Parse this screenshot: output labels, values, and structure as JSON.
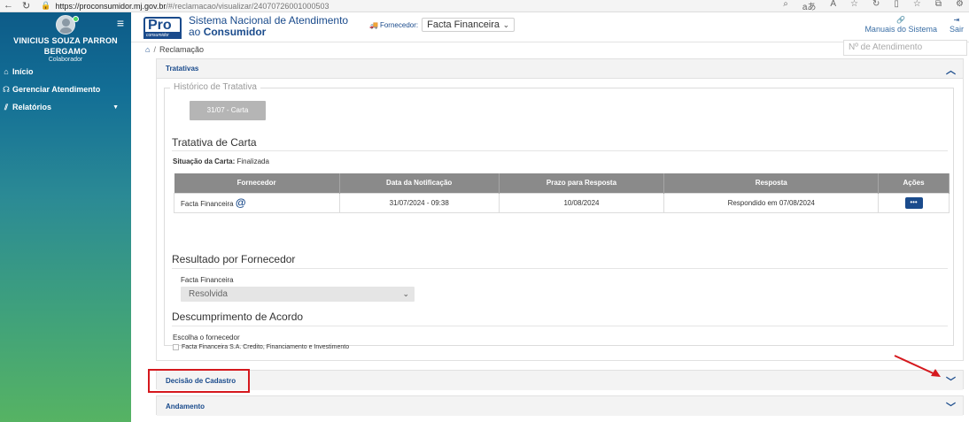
{
  "browser": {
    "url_host": "https://proconsumidor.mj.gov.br",
    "url_path": "/#/reclamacao/visualizar/24070726001000503"
  },
  "sidebar": {
    "user_name_line1": "VINICIUS SOUZA PARRON",
    "user_name_line2": "BERGAMO",
    "user_role": "Colaborador",
    "items": [
      {
        "label": "Início",
        "icon": "home-icon"
      },
      {
        "label": "Gerenciar Atendimento",
        "icon": "headset-icon"
      },
      {
        "label": "Relatórios",
        "icon": "chart-icon"
      }
    ]
  },
  "header": {
    "logo_main": "Pro",
    "logo_sub": "consumidor",
    "title_line1": "Sistema Nacional de Atendimento",
    "title_prefix": "ao ",
    "title_bold": "Consumidor",
    "supplier_label": "Fornecedor:",
    "supplier_value": "Facta Financeira",
    "manuals_label": "Manuais do Sistema",
    "exit_label": "Sair"
  },
  "breadcrumb": {
    "current": "Reclamação",
    "search_placeholder": "Nº de Atendimento"
  },
  "tratativas": {
    "heading": "Tratativas",
    "history_legend": "Histórico de Tratativa",
    "tab_label": "31/07 - Carta",
    "carta_title": "Tratativa de Carta",
    "situacao_label": "Situação da Carta:",
    "situacao_value": "Finalizada",
    "columns": [
      "Fornecedor",
      "Data da Notificação",
      "Prazo para Resposta",
      "Resposta",
      "Ações"
    ],
    "rows": [
      {
        "fornecedor": "Facta Financeira",
        "data": "31/07/2024 - 09:38",
        "prazo": "10/08/2024",
        "resposta": "Respondido em 07/08/2024"
      }
    ],
    "resultado_title": "Resultado por Fornecedor",
    "resultado_fornecedor": "Facta Financeira",
    "resultado_value": "Resolvida",
    "descumprimento_title": "Descumprimento de Acordo",
    "escolha_label": "Escolha o fornecedor",
    "checkbox_label": "Facta Financeira S.A. Credito, Financiamento e Investimento"
  },
  "panels": {
    "decisao": "Decisão de Cadastro",
    "andamento": "Andamento"
  },
  "colors": {
    "brand_blue": "#1a4b8c",
    "highlight_red": "#d5181d",
    "sidebar_top": "#0d5b88",
    "sidebar_bottom": "#56b363"
  }
}
